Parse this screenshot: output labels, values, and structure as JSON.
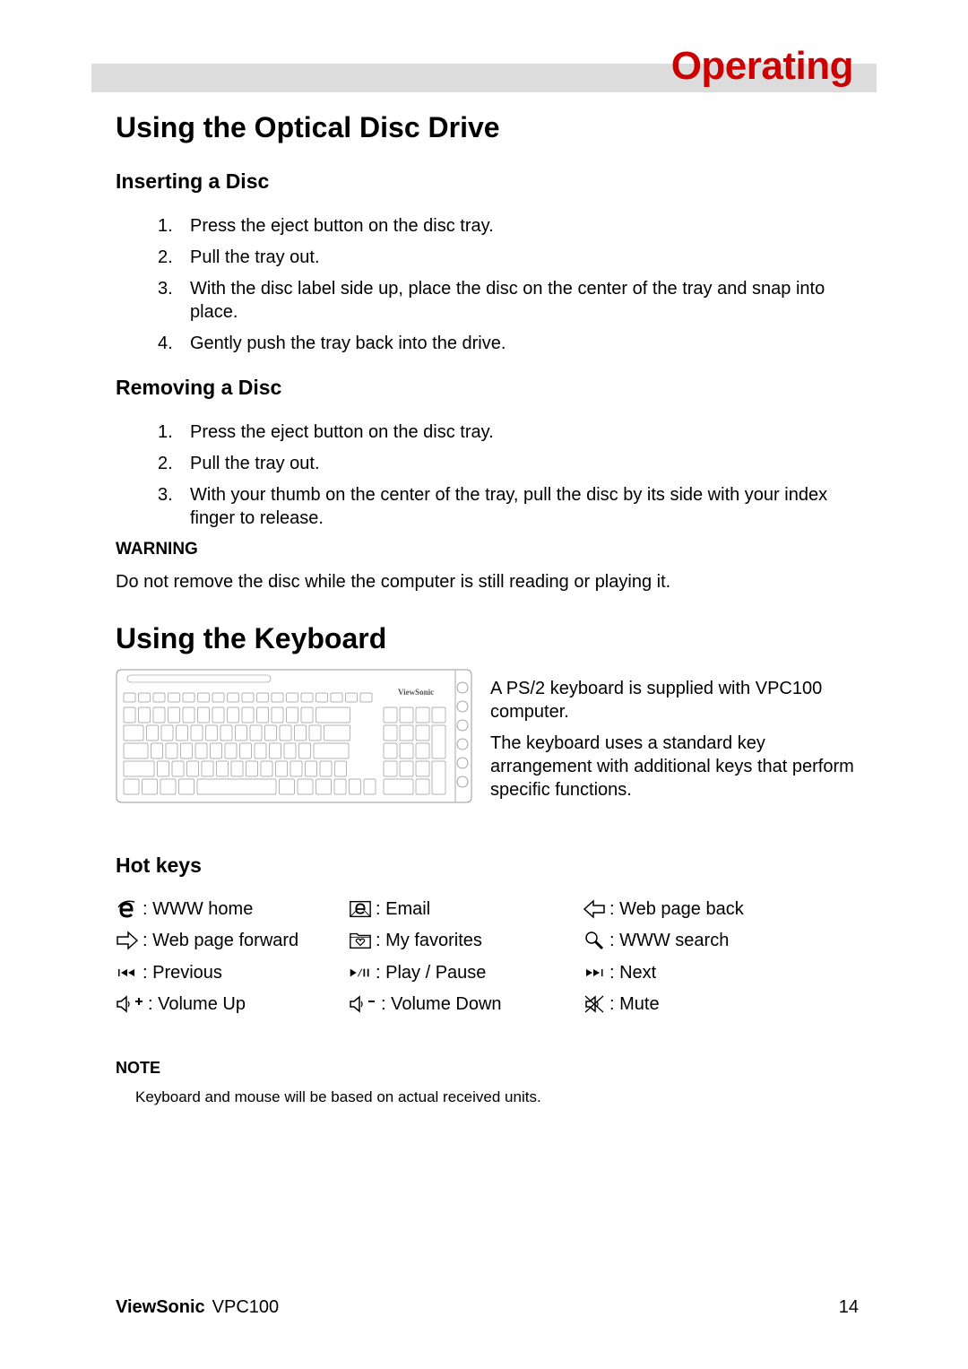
{
  "header": {
    "chapter_title": "Operating",
    "accent_color": "#cc0000",
    "bar_color": "#dcdcdc"
  },
  "optical_drive": {
    "title": "Using the Optical Disc Drive",
    "inserting": {
      "title": "Inserting a Disc",
      "steps": [
        {
          "num": "1.",
          "text": "Press the eject button on the disc tray."
        },
        {
          "num": "2.",
          "text": "Pull the tray out."
        },
        {
          "num": "3.",
          "text": "With the disc label side up, place the disc on the center of the tray and snap into place."
        },
        {
          "num": "4.",
          "text": "Gently push the tray back into the drive."
        }
      ]
    },
    "removing": {
      "title": "Removing a Disc",
      "steps": [
        {
          "num": "1.",
          "text": "Press the eject button on the disc tray."
        },
        {
          "num": "2.",
          "text": "Pull the tray out."
        },
        {
          "num": "3.",
          "text": "With your thumb on the center of the tray, pull the disc by its side with your index finger to release."
        }
      ]
    },
    "warning": {
      "label": "WARNING",
      "text": "Do not remove the disc while the computer is still reading or playing it."
    }
  },
  "keyboard": {
    "title": "Using the Keyboard",
    "image_brand": "ViewSonic",
    "description_1": "A PS/2 keyboard is supplied with VPC100 computer.",
    "description_2": "The keyboard uses a standard key arrangement with additional keys that perform specific functions.",
    "hotkeys_title": "Hot keys",
    "hotkeys": [
      {
        "icon": "internet-explorer-icon",
        "label": ": WWW home"
      },
      {
        "icon": "email-icon",
        "label": ": Email"
      },
      {
        "icon": "arrow-left-outline-icon",
        "label": ": Web page back"
      },
      {
        "icon": "arrow-right-outline-icon",
        "label": ": Web page forward"
      },
      {
        "icon": "favorites-folder-icon",
        "label": ": My favorites"
      },
      {
        "icon": "magnifier-icon",
        "label": ": WWW search"
      },
      {
        "icon": "previous-track-icon",
        "label": ": Previous"
      },
      {
        "icon": "play-pause-icon",
        "label": ": Play / Pause"
      },
      {
        "icon": "next-track-icon",
        "label": ": Next"
      },
      {
        "icon": "volume-up-icon",
        "label": ": Volume Up"
      },
      {
        "icon": "volume-down-icon",
        "label": ": Volume Down"
      },
      {
        "icon": "mute-icon",
        "label": ": Mute"
      }
    ],
    "note": {
      "label": "NOTE",
      "text": "Keyboard and mouse will be based on actual received units."
    }
  },
  "footer": {
    "brand": "ViewSonic",
    "model": "VPC100",
    "page_number": "14"
  }
}
